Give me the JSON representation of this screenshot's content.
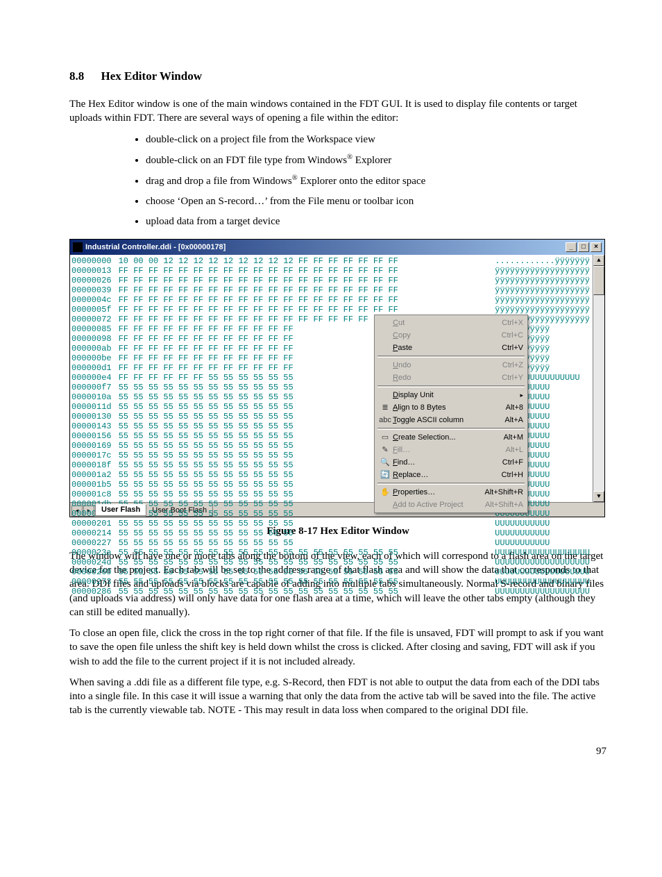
{
  "section": {
    "number": "8.8",
    "title": "Hex Editor Window"
  },
  "intro": "The Hex Editor window is one of the main windows contained in the FDT GUI. It is used to display file contents or target uploads within FDT. There are several ways of opening a file within the editor:",
  "bullets": [
    "double-click on a project file from the Workspace view",
    "double-click on an FDT file type from Windows",
    "drag and drop a file from Windows",
    "choose ‘Open an S-record…’ from the File menu or toolbar icon",
    "upload data from a target device"
  ],
  "bullet_suffix": {
    "1": " Explorer",
    "2": " Explorer onto the editor space"
  },
  "window": {
    "title": "Industrial Controller.ddi - [0x00000178]",
    "tabs": {
      "active": "User Flash",
      "others": [
        "User Boot Flash"
      ]
    }
  },
  "figure_caption": "Figure 8-17 Hex Editor Window",
  "body": {
    "p1": "The window will have one or more tabs along the bottom of the view, each of which will correspond to a flash area on the target device for the project. Each tab will be set to the address range of that flash area and will show the data that corresponds to that area. DDI files and uploads via blocks are capable of adding into multiple tabs simultaneously. Normal S-record and binary files (and uploads via address) will only have data for one flash area at a time, which will leave the other tabs empty (although they can still be edited manually).",
    "p2": "To close an open file, click the cross in the top right corner of that file. If the file is unsaved, FDT will prompt to ask if you want to save the open file unless the shift key is held down whilst the cross is clicked. After closing and saving, FDT will ask if you wish to add the file to the current project if it is not included already.",
    "p3": "When saving a .ddi file as a different file type, e.g. S-Record, then FDT is not able to output the data from each of the DDI tabs into a single file. In this case it will issue a warning that only the data from the active tab will be saved into the file. The active tab is the currently viewable tab. NOTE - This may result in data loss when compared to the original DDI file."
  },
  "page_number": "97",
  "hex": {
    "addresses": [
      "00000000",
      "00000013",
      "00000026",
      "00000039",
      "0000004c",
      "0000005f",
      "00000072",
      "00000085",
      "00000098",
      "000000ab",
      "000000be",
      "000000d1",
      "000000e4",
      "000000f7",
      "0000010a",
      "0000011d",
      "00000130",
      "00000143",
      "00000156",
      "00000169",
      "0000017c",
      "0000018f",
      "000001a2",
      "000001b5",
      "000001c8",
      "000001db",
      "000001ee",
      "00000201",
      "00000214",
      "00000227",
      "0000023a",
      "0000024d",
      "00000260",
      "00000273",
      "00000286"
    ],
    "row_first_hex": "10 00 00 12 12 12 12 12 12 12 12 12 FF FF FF FF FF FF FF",
    "row_first_ascii": "............ÿÿÿÿÿÿÿ",
    "row_ff12": "FF FF FF FF FF FF FF FF FF FF FF FF",
    "row_ff19": "FF FF FF FF FF FF FF FF FF FF FF FF FF FF FF FF FF FF FF",
    "row_ff6_5512": "FF FF FF FF FF FF 55 55 55 55 55 55",
    "row_5512": "55 55 55 55 55 55 55 55 55 55 55 55",
    "row_5519": "55 55 55 55 55 55 55 55 55 55 55 55 55 55 55 55 55 55 55",
    "ascii_y12": "ÿÿÿÿÿÿÿÿÿÿÿ",
    "ascii_y19": "ÿÿÿÿÿÿÿÿÿÿÿÿÿÿÿÿÿÿÿ",
    "ascii_y6u6": "ÿÿÿÿÿÿUUUUUUUUUUU",
    "ascii_u12": "UUUUUUUUUUU",
    "ascii_u19": "UUUUUUUUUUUUUUUUUUU"
  },
  "context_menu": [
    {
      "label": "Cut",
      "accel": "Ctrl+X",
      "disabled": true
    },
    {
      "label": "Copy",
      "accel": "Ctrl+C",
      "disabled": true
    },
    {
      "label": "Paste",
      "accel": "Ctrl+V"
    },
    {
      "sep": true
    },
    {
      "label": "Undo",
      "accel": "Ctrl+Z",
      "disabled": true
    },
    {
      "label": "Redo",
      "accel": "Ctrl+Y",
      "disabled": true
    },
    {
      "sep": true
    },
    {
      "label": "Display Unit",
      "submenu": true
    },
    {
      "icon": "align",
      "label": "Align to 8 Bytes",
      "accel": "Alt+8"
    },
    {
      "icon": "abc",
      "label": "Toggle ASCII column",
      "accel": "Alt+A"
    },
    {
      "sep": true
    },
    {
      "icon": "sel",
      "label": "Create Selection...",
      "accel": "Alt+M"
    },
    {
      "icon": "fill",
      "label": "Fill…",
      "accel": "Alt+L",
      "disabled": true
    },
    {
      "icon": "find",
      "label": "Find…",
      "accel": "Ctrl+F"
    },
    {
      "icon": "repl",
      "label": "Replace…",
      "accel": "Ctrl+H"
    },
    {
      "sep": true
    },
    {
      "icon": "prop",
      "label": "Properties…",
      "accel": "Alt+Shift+R"
    },
    {
      "label": "Add to Active Project",
      "accel": "Alt+Shift+A",
      "disabled": true
    }
  ]
}
